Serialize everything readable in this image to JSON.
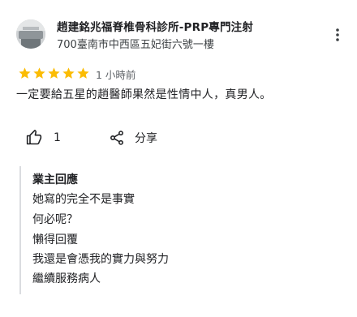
{
  "business": {
    "name": "趙建銘兆福脊椎骨科診所-PRP專門注射",
    "address": "700臺南市中西區五妃街六號一樓",
    "avatar_icon": "business-photo",
    "menu_icon": "more-vert-icon"
  },
  "review": {
    "rating": 5,
    "rating_max": 5,
    "star_color": "#fbbc04",
    "time": "1 小時前",
    "text": "一定要給五星的趙醫師果然是性情中人，真男人。"
  },
  "actions": {
    "like_icon": "thumb-up-icon",
    "like_count": "1",
    "share_icon": "share-icon",
    "share_label": "分享"
  },
  "owner_reply": {
    "title": "業主回應",
    "lines": [
      "她寫的完全不是事實",
      "何必呢？",
      "懶得回覆",
      "我還是會憑我的實力與努力",
      "繼續服務病人"
    ],
    "border_color": "#dadce0"
  }
}
